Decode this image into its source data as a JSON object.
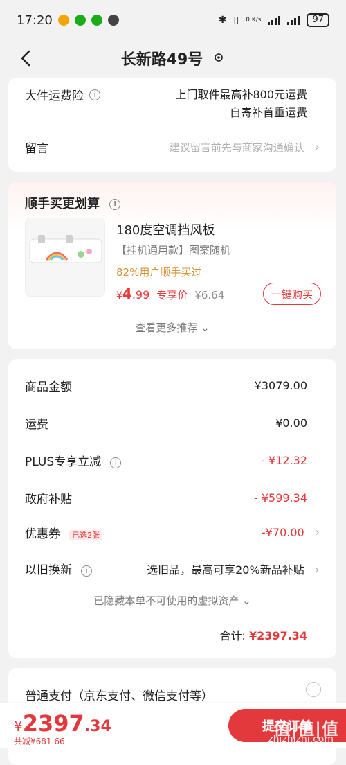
{
  "status": {
    "time": "17:20",
    "net_rate": "0 K/s",
    "battery": "97"
  },
  "header": {
    "title": "长新路49号"
  },
  "insurance": {
    "label": "大件运费险",
    "line1": "上门取件最高补800元运费",
    "line2": "自寄补首重运费"
  },
  "note": {
    "label": "留言",
    "placeholder": "建议留言前先与商家沟通确认"
  },
  "recommend": {
    "title": "顺手买更划算",
    "product_name": "180度空调挡风板",
    "product_desc": "【挂机通用款】图案随机",
    "stat": "82%用户顺手买过",
    "price_symbol": "¥",
    "price_int": "4",
    "price_dec": ".99",
    "exclusive_label": "专享价",
    "old_price": "¥6.64",
    "buy_button": "一键购买",
    "more": "查看更多推荐"
  },
  "summary": {
    "items": [
      {
        "label": "商品金额",
        "value": "¥3079.00"
      },
      {
        "label": "运费",
        "value": "¥0.00"
      },
      {
        "label": "PLUS专享立减",
        "value": "- ¥12.32"
      },
      {
        "label": "政府补贴",
        "value": "- ¥599.34"
      },
      {
        "label": "优惠券",
        "value": "-¥70.00",
        "tag": "已选2张"
      },
      {
        "label": "以旧换新",
        "value": "选旧品，最高可享20%新品补贴"
      }
    ],
    "hidden_assets": "已隐藏本单不可使用的虚拟资产",
    "total_label": "合计:",
    "total_value": "¥2397.34"
  },
  "payment": {
    "title": "普通支付（京东支付、微信支付等）"
  },
  "bottom": {
    "yen": "¥",
    "price_int": "2397",
    "price_dec": ".34",
    "saved": "共减¥681.66",
    "submit": "提交订单",
    "watermark": "值|值|值",
    "watermark_site": "zhizhizhi.com"
  },
  "colors": {
    "accent": "#e4393c",
    "stat": "#d79235",
    "background": "#f2f2f2"
  }
}
